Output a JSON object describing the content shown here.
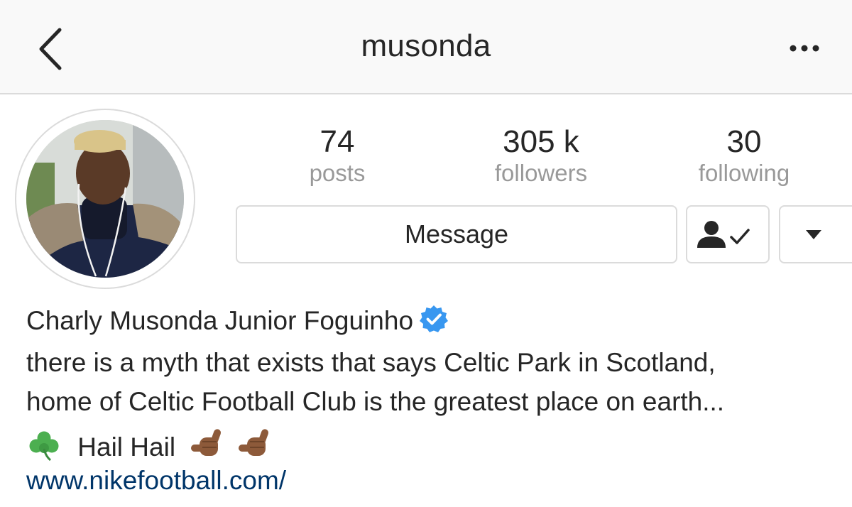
{
  "header": {
    "title": "musonda",
    "back_icon": "chevron-left-icon",
    "more_icon": "ellipsis-icon"
  },
  "stats": {
    "posts": {
      "value": "74",
      "label": "posts"
    },
    "followers": {
      "value": "305 k",
      "label": "followers"
    },
    "following": {
      "value": "30",
      "label": "following"
    }
  },
  "actions": {
    "message_label": "Message",
    "following_icon": "person-check-icon",
    "dropdown_icon": "triangle-down-icon"
  },
  "profile": {
    "name": "Charly Musonda Junior Foguinho",
    "verified": true,
    "bio_line1": "there is a myth that exists that says Celtic Park in Scotland,",
    "bio_line2": "home of Celtic Football Club is the greatest place on earth...",
    "bio_line3_text": "Hail Hail",
    "bio_line3_emoji": [
      "shamrock",
      "call-me-hand",
      "call-me-hand"
    ],
    "website": "www.nikefootball.com/"
  },
  "colors": {
    "text": "#262626",
    "muted": "#999999",
    "border": "#dbdbdb",
    "link": "#003569",
    "verified": "#3897f0",
    "navbar_bg": "#f9f9f9"
  }
}
